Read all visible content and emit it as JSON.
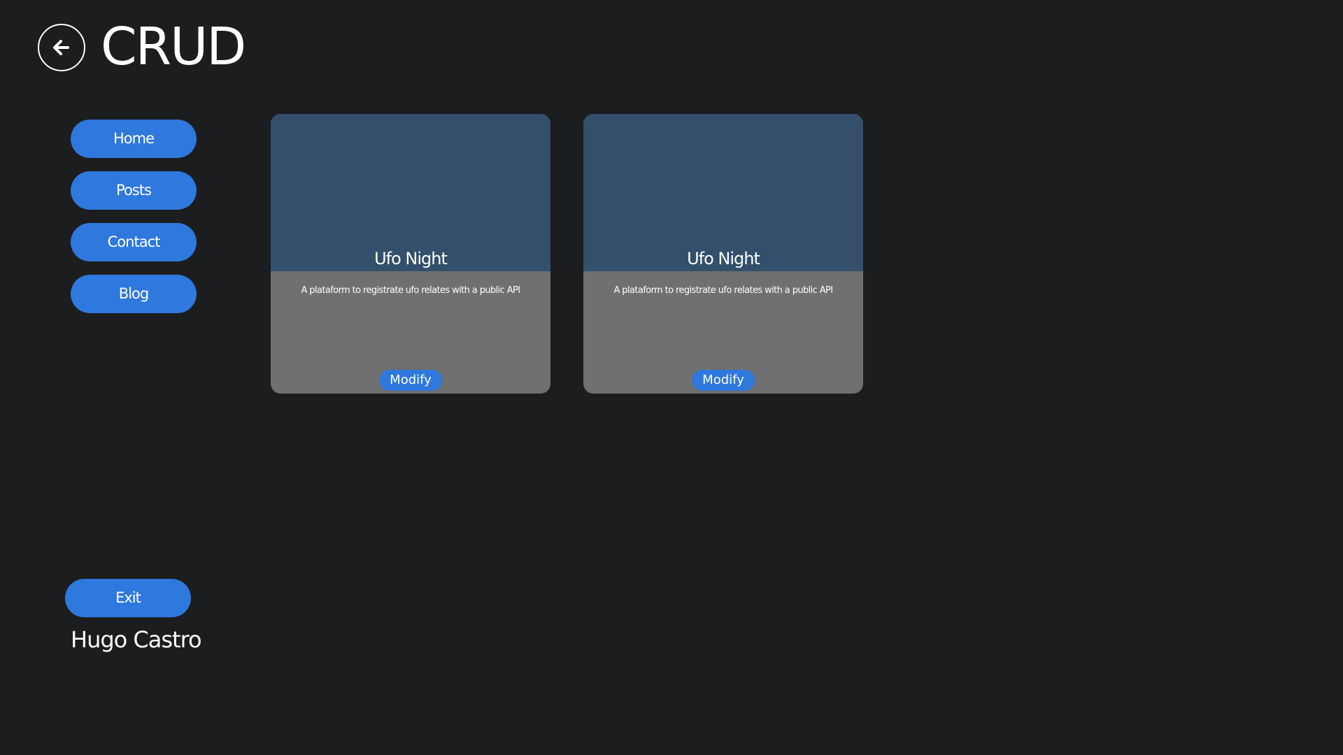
{
  "header": {
    "back_icon": "arrow-left-circle-icon",
    "title": "CRUD"
  },
  "nav": {
    "items": [
      {
        "label": "Home"
      },
      {
        "label": "Posts"
      },
      {
        "label": "Contact"
      },
      {
        "label": "Blog"
      }
    ]
  },
  "footer": {
    "exit_label": "Exit",
    "user_name": "Hugo Castro"
  },
  "cards": [
    {
      "title": "Ufo Night",
      "description": "A plataform to registrate ufo relates with a public API",
      "button_label": "Modify"
    },
    {
      "title": "Ufo Night",
      "description": "A plataform to registrate ufo relates with a public API",
      "button_label": "Modify"
    }
  ],
  "colors": {
    "background": "#1c1d1f",
    "accent": "#2f78dd",
    "card_header": "#334f6b",
    "card_body": "#707070"
  }
}
